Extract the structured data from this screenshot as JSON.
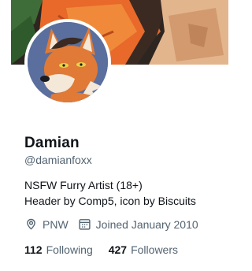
{
  "profile": {
    "display_name": "Damian",
    "handle": "@damianfoxx",
    "bio_lines": [
      "NSFW Furry Artist (18+)",
      "Header by Comp5, icon by Biscuits"
    ],
    "location": "PNW",
    "joined": "Joined January 2010",
    "following_count": "112",
    "following_label": "Following",
    "followers_count": "427",
    "followers_label": "Followers"
  },
  "icons": {
    "location": "location-pin-icon",
    "joined": "calendar-icon"
  },
  "colors": {
    "primary_text": "#0f1419",
    "secondary_text": "#536471",
    "avatar_background": "#5a6f9e",
    "banner_orange": "#e8692a"
  }
}
